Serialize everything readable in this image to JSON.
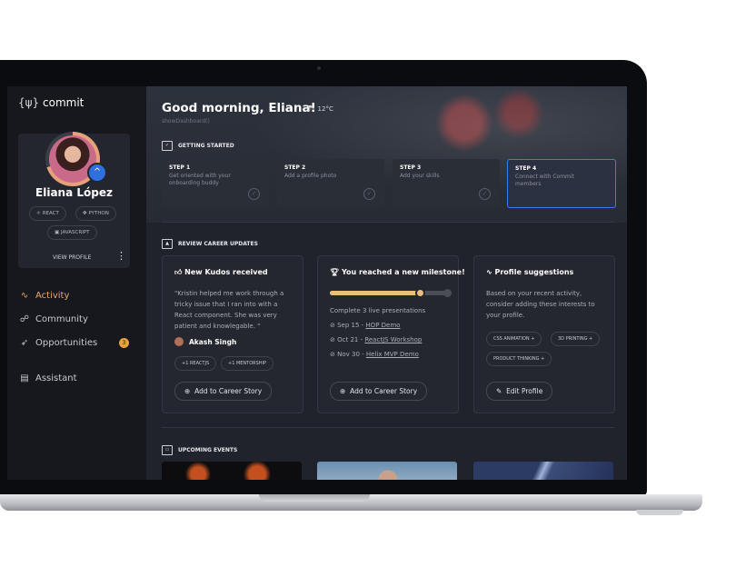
{
  "sidebar": {
    "logo_brace": "{ψ}",
    "logo_text": "commit",
    "profile": {
      "name": "Eliana López",
      "skills": [
        "REACT",
        "PYTHON",
        "JAVASCRIPT"
      ],
      "view_profile": "VIEW PROFILE"
    },
    "nav": [
      {
        "label": "Activity",
        "icon": "activity-icon",
        "active": true
      },
      {
        "label": "Community",
        "icon": "community-icon"
      },
      {
        "label": "Opportunities",
        "icon": "rocket-icon",
        "badge": "3"
      },
      {
        "label": "Assistant",
        "icon": "chat-icon"
      }
    ]
  },
  "header": {
    "greeting": "Good morning, Eliana!",
    "temperature": "12°C",
    "subtitle": "showDashboard()"
  },
  "getting_started": {
    "title": "GETTING STARTED",
    "steps": [
      {
        "label": "STEP 1",
        "desc": "Get oriented with your onboarding buddy"
      },
      {
        "label": "STEP 2",
        "desc": "Add a profile photo"
      },
      {
        "label": "STEP 3",
        "desc": "Add your skills"
      },
      {
        "label": "STEP 4",
        "desc": "Connect with Commit members"
      }
    ]
  },
  "career": {
    "title": "REVIEW CAREER UPDATES",
    "kudos": {
      "title": "New Kudos received",
      "quote": "\"Kristin helped me work through a tricky issue that I ran into with a React component. She was very patient and knowlegable. \"",
      "author": "Akash Singh",
      "tags": [
        "+1  REACTJS",
        "+1  MENTORSHIP"
      ],
      "button": "Add to Career Story"
    },
    "milestone": {
      "title": "You reached a new milestone!",
      "progress": 0.75,
      "desc": "Complete 3 live presentations",
      "items": [
        {
          "date": "Sep 15 - ",
          "name": "HOP Demo"
        },
        {
          "date": "Oct 21 - ",
          "name": "ReactJS Workshop"
        },
        {
          "date": "Nov 30 - ",
          "name": "Helix MVP Demo"
        }
      ],
      "button": "Add to Career Story"
    },
    "suggestions": {
      "title": "Profile suggestions",
      "desc": "Based on your recent activity, consider adding these interests to your profile.",
      "tags": [
        "CSS ANIMATION  +",
        "3D PRINTING  +",
        "PRODUCT THINKING  +"
      ],
      "button": "Edit Profile"
    }
  },
  "events": {
    "title": "UPCOMING EVENTS"
  },
  "colors": {
    "accent": "#e2a86e",
    "step_highlight": "#3b7bea",
    "sidebar_bg": "#16181e",
    "main_bg": "#20232c"
  }
}
